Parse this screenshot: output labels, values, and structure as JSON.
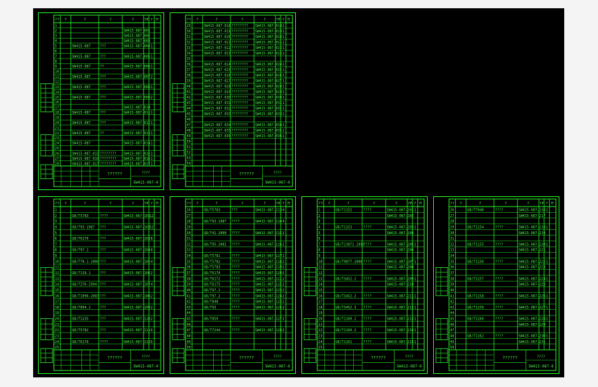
{
  "viewport": {
    "background": "#000000",
    "line_color": "#2aff2a",
    "text_color": "#4dff4d"
  },
  "sheets": [
    {
      "id": "sheet-1",
      "header": [
        "??",
        "?",
        "?",
        "?",
        "?",
        "??",
        "? ? ?",
        "?"
      ],
      "title_block": {
        "name": "??????",
        "code": "????",
        "doc": "SW415-087-0"
      },
      "rows": [
        [
          "1",
          "",
          "",
          "",
          ""
        ],
        [
          "2",
          "",
          "",
          "SW415-087-001",
          ""
        ],
        [
          "3",
          "",
          "",
          "SW415-087-002",
          ""
        ],
        [
          "4",
          "",
          "",
          "SW415-087-003",
          ""
        ],
        [
          "5",
          "SW415-087",
          "???",
          "SW415-087-004",
          "1"
        ],
        [
          "6",
          "",
          "",
          "",
          ""
        ],
        [
          "7",
          "SW415-087",
          "???",
          "SW415-087-005",
          "1"
        ],
        [
          "8",
          "",
          "",
          "",
          ""
        ],
        [
          "9",
          "SW415-087",
          "??",
          "SW415-087-006",
          "1"
        ],
        [
          "10",
          "",
          "",
          "",
          ""
        ],
        [
          "11",
          "SW415-087",
          "???",
          "SW415-087-007",
          "2"
        ],
        [
          "12",
          "",
          "",
          "",
          ""
        ],
        [
          "13",
          "SW415-087",
          "???",
          "SW415-087-008",
          "1"
        ],
        [
          "14",
          "",
          "",
          "",
          ""
        ],
        [
          "15",
          "SW415-087",
          "???",
          "SW415-087-009",
          "2"
        ],
        [
          "16",
          "",
          "",
          "",
          ""
        ],
        [
          "17",
          "",
          "",
          "SW415-087-010",
          ""
        ],
        [
          "18",
          "SW415-087",
          "???",
          "SW415-087-011",
          "1"
        ],
        [
          "19",
          "",
          "",
          "",
          ""
        ],
        [
          "20",
          "SW415-087",
          "???",
          "SW415-087-012",
          "1"
        ],
        [
          "21",
          "",
          "",
          "",
          ""
        ],
        [
          "22",
          "SW415-087",
          "??",
          "SW415-087-013",
          "1"
        ],
        [
          "23",
          "",
          "",
          "",
          ""
        ],
        [
          "24",
          "SW415-087",
          "",
          "SW415-087-014",
          "1"
        ],
        [
          "25",
          "",
          "",
          "",
          ""
        ],
        [
          "26",
          "SW415-087-015",
          "????????",
          "SW415-087-015",
          "1"
        ],
        [
          "27",
          "SW415-087-016",
          "????????",
          "SW415-087-016",
          "1"
        ],
        [
          "28",
          "SW415-087-017",
          "????????",
          "SW415-087-017",
          "1"
        ]
      ]
    },
    {
      "id": "sheet-2",
      "header": [
        "??",
        "?",
        "?",
        "?",
        "?",
        "??",
        "? ? ?",
        "?"
      ],
      "title_block": {
        "name": "??????",
        "code": "????",
        "doc": "SW415-087-0"
      },
      "rows": [
        [
          "29",
          "SW415-087-018",
          "????????",
          "SW415-087-018",
          "1"
        ],
        [
          "30",
          "SW415-087-019",
          "????????",
          "SW415-087-019",
          "1"
        ],
        [
          "31",
          "SW415-087-020",
          "????????",
          "SW415-087-020",
          "1"
        ],
        [
          "32",
          "SW415-087-021",
          "????????",
          "SW415-087-021",
          "1"
        ],
        [
          "33",
          "SW415-087-022",
          "????????",
          "SW415-087-022",
          "1"
        ],
        [
          "34",
          "SW415-087-023",
          "????????",
          "SW415-087-023",
          "1"
        ],
        [
          "35",
          "",
          "",
          "",
          ""
        ],
        [
          "36",
          "SW415-087-024",
          "????????",
          "SW415-087-024",
          "1"
        ],
        [
          "37",
          "SW415-087-025",
          "????????",
          "SW415-087-025",
          "1"
        ],
        [
          "38",
          "SW415-087-026",
          "????????",
          "SW415-087-026",
          "1"
        ],
        [
          "39",
          "SW415-087-027",
          "????????",
          "SW415-087-027",
          "1"
        ],
        [
          "40",
          "SW415-087-028",
          "????????",
          "SW415-087-028",
          "1"
        ],
        [
          "41",
          "SW415-087-029",
          "????????",
          "SW415-087-029",
          "1"
        ],
        [
          "42",
          "SW415-087-030",
          "????????",
          "SW415-087-030",
          "1"
        ],
        [
          "43",
          "SW415-087-031",
          "????????",
          "SW415-087-031",
          "1"
        ],
        [
          "44",
          "SW415-087-032",
          "????????",
          "SW415-087-032",
          "1"
        ],
        [
          "45",
          "SW415-087-033",
          "????????",
          "SW415-087-033",
          "1"
        ],
        [
          "46",
          "",
          "",
          "",
          ""
        ],
        [
          "47",
          "SW415-087-034",
          "????????",
          "SW415-087-034",
          "1"
        ],
        [
          "48",
          "SW415-087-035",
          "????????",
          "SW415-087-035",
          "1"
        ],
        [
          "49",
          "SW415-087-036",
          "????????",
          "SW415-087-036",
          "1"
        ],
        [
          "50",
          "",
          "",
          "",
          ""
        ],
        [
          "51",
          "",
          "",
          "",
          ""
        ],
        [
          "52",
          "",
          "",
          "",
          ""
        ],
        [
          "53",
          "",
          "",
          "",
          ""
        ],
        [
          "54",
          "",
          "",
          "",
          ""
        ]
      ]
    },
    {
      "id": "sheet-3",
      "header": [
        "??",
        "?",
        "?",
        "?",
        "?",
        "??",
        "? ? ?",
        "?"
      ],
      "title_block": {
        "name": "??????",
        "code": "????",
        "doc": "SW415-087-0"
      },
      "rows": [
        [
          "1",
          "",
          "",
          "",
          ""
        ],
        [
          "2",
          "GB/T5783",
          "????",
          "SW415-087-101",
          "12"
        ],
        [
          "3",
          "",
          "",
          "",
          ""
        ],
        [
          "4",
          "GB/T93-1987",
          "???",
          "SW415-087-102",
          "12"
        ],
        [
          "5",
          "",
          "",
          "",
          ""
        ],
        [
          "6",
          "GB/T6170",
          "???",
          "SW415-087-103",
          "8"
        ],
        [
          "7",
          "",
          "",
          "",
          ""
        ],
        [
          "8",
          "GB/T97.1",
          "???",
          "SW415-087-104",
          "8"
        ],
        [
          "9",
          "",
          "",
          "",
          ""
        ],
        [
          "10",
          "GB/T70.1-2000",
          "???",
          "SW415-087-105",
          "4"
        ],
        [
          "11",
          "",
          "",
          "",
          ""
        ],
        [
          "12",
          "GB/T119.1",
          "???",
          "SW415-087-106",
          "2"
        ],
        [
          "13",
          "",
          "",
          "",
          ""
        ],
        [
          "14",
          "GB/T276-1994",
          "???",
          "SW415-087-107",
          "4"
        ],
        [
          "15",
          "",
          "",
          "",
          ""
        ],
        [
          "16",
          "GB/T1096-2003",
          "???",
          "SW415-087-108",
          "2"
        ],
        [
          "17",
          "",
          "",
          "",
          ""
        ],
        [
          "18",
          "GB/T894.1",
          "???",
          "SW415-087-109",
          "2"
        ],
        [
          "19",
          "",
          "",
          "",
          ""
        ],
        [
          "20",
          "GB/T1235",
          "???",
          "SW415-087-110",
          "2"
        ],
        [
          "21",
          "",
          "",
          "",
          ""
        ],
        [
          "22",
          "GB/T5782",
          "???",
          "SW415-087-111",
          "6"
        ],
        [
          "23",
          "",
          "",
          "",
          ""
        ],
        [
          "24",
          "GB/T6170",
          "????",
          "SW415-087-112",
          "6"
        ],
        [
          "25",
          "",
          "",
          "",
          ""
        ]
      ]
    },
    {
      "id": "sheet-4",
      "header": [
        "??",
        "?",
        "?",
        "?",
        "?",
        "??",
        "? ? ?",
        "?"
      ],
      "title_block": {
        "name": "??????",
        "code": "????",
        "doc": "SW415-087-0"
      },
      "rows": [
        [
          "26",
          "GB/T5783",
          "???",
          "SW415-087-113",
          "4"
        ],
        [
          "27",
          "",
          "",
          "",
          ""
        ],
        [
          "28",
          "GB/T93-1987",
          "????",
          "SW415-087-114",
          "4"
        ],
        [
          "29",
          "",
          "",
          "",
          ""
        ],
        [
          "30",
          "GB/T41-2000",
          "????",
          "SW415-087-115",
          "2"
        ],
        [
          "31",
          "",
          "",
          "",
          ""
        ],
        [
          "32",
          "GB/T95-2002",
          "????",
          "SW415-087-116",
          "2"
        ],
        [
          "33",
          "",
          "",
          "",
          ""
        ],
        [
          "34",
          "GB/T5781",
          "????",
          "SW415-087-117",
          "2"
        ],
        [
          "35",
          "GB/T5782",
          "????",
          "SW415-087-118",
          "2"
        ],
        [
          "36",
          "GB/T5783",
          "????",
          "SW415-087-119",
          "2"
        ],
        [
          "37",
          "GB/T6170",
          "????",
          "SW415-087-120",
          "2"
        ],
        [
          "38",
          "GB/T6172",
          "????",
          "SW415-087-121",
          "2"
        ],
        [
          "39",
          "GB/T6175",
          "????",
          "SW415-087-122",
          "2"
        ],
        [
          "40",
          "GB/T97.1",
          "????",
          "SW415-087-123",
          "2"
        ],
        [
          "41",
          "GB/T97.2",
          "????",
          "SW415-087-124",
          "2"
        ],
        [
          "42",
          "GB/T848",
          "????",
          "SW415-087-125",
          "2"
        ],
        [
          "43",
          "GB/T93",
          "????",
          "SW415-087-126",
          "2"
        ],
        [
          "44",
          "",
          "",
          "",
          ""
        ],
        [
          "45",
          "GB/T859",
          "????",
          "SW415-087-127",
          "2"
        ],
        [
          "46",
          "",
          "",
          "",
          ""
        ],
        [
          "47",
          "GB/T7244",
          "????",
          "SW415-087-128",
          "2"
        ],
        [
          "48",
          "",
          "",
          "",
          ""
        ],
        [
          "49",
          "",
          "",
          "",
          ""
        ],
        [
          "50",
          "",
          "",
          "",
          ""
        ]
      ]
    },
    {
      "id": "sheet-5",
      "header": [
        "??",
        "?",
        "?",
        "?",
        "?",
        "??",
        "? ? ?",
        "?"
      ],
      "title_block": {
        "name": "??????",
        "code": "????",
        "doc": "SW415-087-0"
      },
      "rows": [
        [
          "1",
          "GB/T1152",
          "????",
          "SW415-087-201",
          "1"
        ],
        [
          "2",
          "",
          "",
          "SW415-087-202",
          ""
        ],
        [
          "3",
          "",
          "",
          "",
          ""
        ],
        [
          "4",
          "GB/T1153",
          "????",
          "SW415-087-203",
          "1"
        ],
        [
          "5",
          "",
          "",
          "SW415-087-204",
          ""
        ],
        [
          "6",
          "",
          "",
          "",
          ""
        ],
        [
          "7",
          "GB/T13871-1992",
          "????",
          "SW415-087-205",
          "1"
        ],
        [
          "8",
          "",
          "",
          "SW415-087-206",
          ""
        ],
        [
          "9",
          "",
          "",
          "",
          ""
        ],
        [
          "10",
          "GB/T9877-2008",
          "????",
          "SW415-087-207",
          "1"
        ],
        [
          "11",
          "",
          "",
          "SW415-087-208",
          ""
        ],
        [
          "12",
          "",
          "",
          "",
          ""
        ],
        [
          "13",
          "GB/T3452.1",
          "????",
          "SW415-087-209",
          "1"
        ],
        [
          "14",
          "",
          "",
          "SW415-087-210",
          ""
        ],
        [
          "15",
          "",
          "",
          "",
          ""
        ],
        [
          "16",
          "GB/T3452.2",
          "????",
          "SW415-087-211",
          "1"
        ],
        [
          "17",
          "",
          "",
          "",
          ""
        ],
        [
          "18",
          "GB/T3452.3",
          "????",
          "SW415-087-212",
          "1"
        ],
        [
          "19",
          "",
          "",
          "",
          ""
        ],
        [
          "20",
          "GB/T1160.1",
          "????",
          "SW415-087-213",
          "1"
        ],
        [
          "21",
          "",
          "",
          "",
          ""
        ],
        [
          "22",
          "GB/T1160.2",
          "????",
          "SW415-087-214",
          "1"
        ],
        [
          "23",
          "",
          "",
          "",
          ""
        ],
        [
          "24",
          "GB/T1161",
          "????",
          "SW415-087-215",
          "1"
        ],
        [
          "25",
          "",
          "",
          "",
          ""
        ]
      ]
    },
    {
      "id": "sheet-6",
      "header": [
        "??",
        "?",
        "?",
        "?",
        "?",
        "??",
        "? ? ?",
        "?"
      ],
      "title_block": {
        "name": "??????",
        "code": "????",
        "doc": "SW415-087-0"
      },
      "rows": [
        [
          "26",
          "GB/T7940",
          "????",
          "SW415-087-216",
          "1"
        ],
        [
          "27",
          "",
          "",
          "SW415-087-217",
          ""
        ],
        [
          "28",
          "",
          "",
          "",
          ""
        ],
        [
          "29",
          "GB/T1154",
          "????",
          "SW415-087-218",
          "1"
        ],
        [
          "30",
          "",
          "",
          "SW415-087-219",
          ""
        ],
        [
          "31",
          "",
          "",
          "",
          ""
        ],
        [
          "32",
          "GB/T1155",
          "????",
          "SW415-087-220",
          "1"
        ],
        [
          "33",
          "",
          "",
          "SW415-087-221",
          ""
        ],
        [
          "34",
          "",
          "",
          "",
          ""
        ],
        [
          "35",
          "GB/T1156",
          "????",
          "SW415-087-222",
          "1"
        ],
        [
          "36",
          "",
          "",
          "SW415-087-223",
          ""
        ],
        [
          "37",
          "",
          "",
          "",
          ""
        ],
        [
          "38",
          "GB/T1157",
          "????",
          "SW415-087-224",
          "1"
        ],
        [
          "39",
          "",
          "",
          "SW415-087-225",
          ""
        ],
        [
          "40",
          "",
          "",
          "",
          ""
        ],
        [
          "41",
          "GB/T1158",
          "????",
          "SW415-087-226",
          "1"
        ],
        [
          "42",
          "",
          "",
          "",
          ""
        ],
        [
          "43",
          "GB/T1159",
          "????",
          "SW415-087-227",
          "1"
        ],
        [
          "44",
          "",
          "",
          "",
          ""
        ],
        [
          "45",
          "GB/T1160",
          "????",
          "SW415-087-228",
          "1"
        ],
        [
          "46",
          "",
          "",
          "SW415-087-229",
          ""
        ],
        [
          "47",
          "",
          "",
          "",
          ""
        ],
        [
          "48",
          "GB/T1162",
          "????",
          "SW415-087-230",
          "1"
        ],
        [
          "49",
          "",
          "",
          "SW415-087-231",
          ""
        ],
        [
          "50",
          "",
          "",
          "",
          ""
        ]
      ]
    }
  ]
}
